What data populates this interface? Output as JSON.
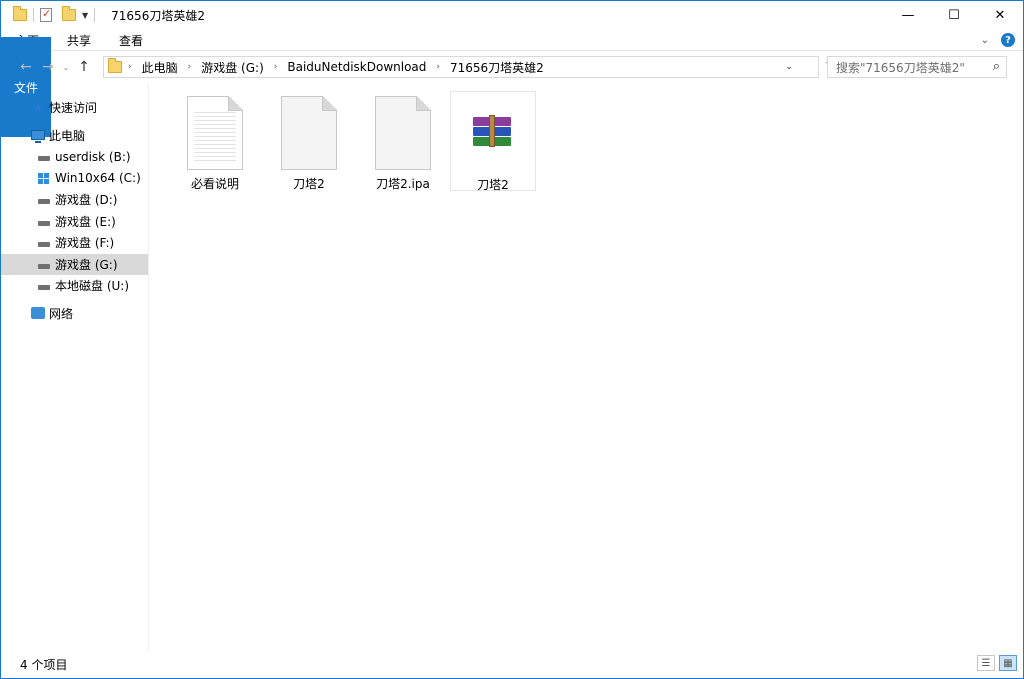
{
  "window": {
    "title": "71656刀塔英雄2",
    "controls": {
      "minimize": "—",
      "maximize": "☐",
      "close": "✕"
    }
  },
  "ribbon": {
    "tabs": [
      "文件",
      "主页",
      "共享",
      "查看"
    ],
    "expand_glyph": "⌄",
    "help_glyph": "?"
  },
  "nav": {
    "back_glyph": "←",
    "forward_glyph": "→",
    "recent_glyph": "⌄",
    "up_glyph": "↑"
  },
  "address": {
    "crumbs": [
      "此电脑",
      "游戏盘 (G:)",
      "BaiduNetdiskDownload",
      "71656刀塔英雄2"
    ],
    "separator": "›",
    "dropdown_glyph": "⌄",
    "refresh_glyph": "↻"
  },
  "search": {
    "placeholder": "搜索\"71656刀塔英雄2\"",
    "icon_glyph": "⌕"
  },
  "sidebar": {
    "quick_access": "快速访问",
    "this_pc": "此电脑",
    "drives": [
      {
        "label": "userdisk (B:)",
        "icon": "drive-icon"
      },
      {
        "label": "Win10x64 (C:)",
        "icon": "windows-drive-icon"
      },
      {
        "label": "游戏盘 (D:)",
        "icon": "drive-icon"
      },
      {
        "label": "游戏盘 (E:)",
        "icon": "drive-icon"
      },
      {
        "label": "游戏盘 (F:)",
        "icon": "drive-icon"
      },
      {
        "label": "游戏盘 (G:)",
        "icon": "drive-icon",
        "selected": true
      },
      {
        "label": "本地磁盘 (U:)",
        "icon": "drive-icon"
      }
    ],
    "network": "网络"
  },
  "files": [
    {
      "name": "必看说明",
      "icon": "text-document-icon"
    },
    {
      "name": "刀塔2",
      "icon": "blank-file-icon"
    },
    {
      "name": "刀塔2.ipa",
      "icon": "blank-file-icon"
    },
    {
      "name": "刀塔2",
      "icon": "winrar-archive-icon",
      "selected": true
    }
  ],
  "status": {
    "item_count": "4 个项目"
  },
  "colors": {
    "accent": "#1979ca",
    "selection_gray": "#d9d9d9"
  }
}
